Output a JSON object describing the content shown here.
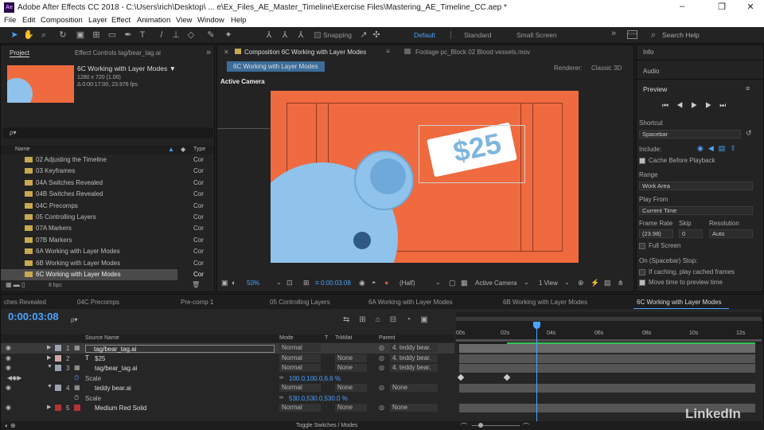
{
  "window": {
    "app_icon": "Ae",
    "title": "Adobe After Effects CC 2018 - C:\\Users\\rich\\Desktop\\ ... e\\Ex_Files_AE_Master_Timeline\\Exercise Files\\Mastering_AE_Timeline_CC.aep *",
    "controls": [
      "–",
      "❐",
      "✕"
    ]
  },
  "menu": [
    "File",
    "Edit",
    "Composition",
    "Layer",
    "Effect",
    "Animation",
    "View",
    "Window",
    "Help"
  ],
  "toolbar": {
    "snapping": "Snapping",
    "workspaces": [
      "Default",
      "Standard",
      "Small Screen"
    ],
    "search_placeholder": "Search Help",
    "overflow": "»"
  },
  "project": {
    "tab": "Project",
    "tab2": "Effect Controls tag/bear_tag.ai",
    "comp_name": "6C Working with Layer Modes ▼",
    "comp_info1": "1280 x 720 (1.00)",
    "comp_info2": "Δ 0:00:17:00, 23.976 fps",
    "search_placeholder": "ρ▾",
    "col_name": "Name",
    "col_type": "Type",
    "bpc": "8 bpc",
    "items": [
      {
        "name": "02 Adjusting the Timeline",
        "type": "Cor"
      },
      {
        "name": "03 Keyframes",
        "type": "Cor"
      },
      {
        "name": "04A Switches Revealed",
        "type": "Cor"
      },
      {
        "name": "04B Switches Revealed",
        "type": "Cor"
      },
      {
        "name": "04C Precomps",
        "type": "Cor"
      },
      {
        "name": "05 Controlling Layers",
        "type": "Cor"
      },
      {
        "name": "07A Markers",
        "type": "Cor"
      },
      {
        "name": "07B Markers",
        "type": "Cor"
      },
      {
        "name": "6A Working with Layer Modes",
        "type": "Cor"
      },
      {
        "name": "6B Working with Layer Modes",
        "type": "Cor"
      },
      {
        "name": "6C Working with Layer Modes",
        "type": "Cor"
      }
    ]
  },
  "viewer": {
    "tab": "Composition 6C Working with Layer Modes",
    "subtab": "6C Working with Layer Modes",
    "footage_tab": "Footage pc_Block 02 Blood vessels.mov",
    "renderer_label": "Renderer:",
    "renderer": "Classic 3D",
    "camera_label": "Active Camera",
    "price": "$25",
    "zoom": "50%",
    "timecode": "0:00:03:08",
    "resolution": "(Half)",
    "view_camera": "Active Camera",
    "views": "1 View",
    "color_dot": "#ef6a3f"
  },
  "right": {
    "info": "Info",
    "audio": "Audio",
    "preview": "Preview",
    "shortcut_label": "Shortcut",
    "shortcut": "Spacebar",
    "include_label": "Include:",
    "cache": "Cache Before Playback",
    "range_label": "Range",
    "range": "Work Area",
    "play_from_label": "Play From",
    "play_from": "Current Time",
    "framerate_label": "Frame Rate",
    "skip_label": "Skip",
    "resolution_label": "Resolution",
    "framerate": "(23.98)",
    "skip": "0",
    "resolution": "Auto",
    "full_screen": "Full Screen",
    "on_spacebar": "On (Spacebar) Stop:",
    "if_caching": "If caching, play cached frames",
    "move_time": "Move time to preview time"
  },
  "timeline": {
    "tabs": [
      "ches Revealed",
      "04C Precomps",
      "Pre-comp 1",
      "05 Controlling Layers",
      "6A Working with Layer Modes",
      "6B Working with Layer Modes",
      "6C Working with Layer Modes"
    ],
    "timecode": "0:00:03:08",
    "search_placeholder": "ρ▾",
    "col_source": "Source Name",
    "col_mode": "Mode",
    "col_t": "T",
    "col_trkmat": "TrkMat",
    "col_parent": "Parent",
    "ruler": [
      "00s",
      "02s",
      "04s",
      "06s",
      "08s",
      "10s",
      "12s"
    ],
    "toggle": "Toggle Switches / Modes",
    "layers": [
      {
        "num": "1",
        "name": "tag/bear_tag.ai",
        "mode": "Normal",
        "trkmat": "",
        "parent": "4. teddy bear."
      },
      {
        "num": "2",
        "name": "$25",
        "mode": "Normal",
        "trkmat": "None",
        "parent": "4. teddy bear."
      },
      {
        "num": "3",
        "name": "tag/bear_tag.ai",
        "mode": "Normal",
        "trkmat": "None",
        "parent": "4. teddy bear."
      },
      {
        "num": "",
        "name": "Scale",
        "mode": "",
        "trkmat": "",
        "parent": "",
        "value": "100.0,100.0,6.6 %"
      },
      {
        "num": "4",
        "name": "teddy bear.ai",
        "mode": "Normal",
        "trkmat": "None",
        "parent": "None"
      },
      {
        "num": "",
        "name": "Scale",
        "mode": "",
        "trkmat": "",
        "parent": "",
        "value": "530.0,530.0,530.0 %"
      },
      {
        "num": "5",
        "name": "Medium Red Solid",
        "mode": "Normal",
        "trkmat": "None",
        "parent": "None"
      }
    ],
    "label_colors": [
      "#9aa3b0",
      "#d2a5a5",
      "#9aa3b0",
      "#9aa3b0",
      "#b53333"
    ]
  },
  "watermark": "LinkedIn"
}
